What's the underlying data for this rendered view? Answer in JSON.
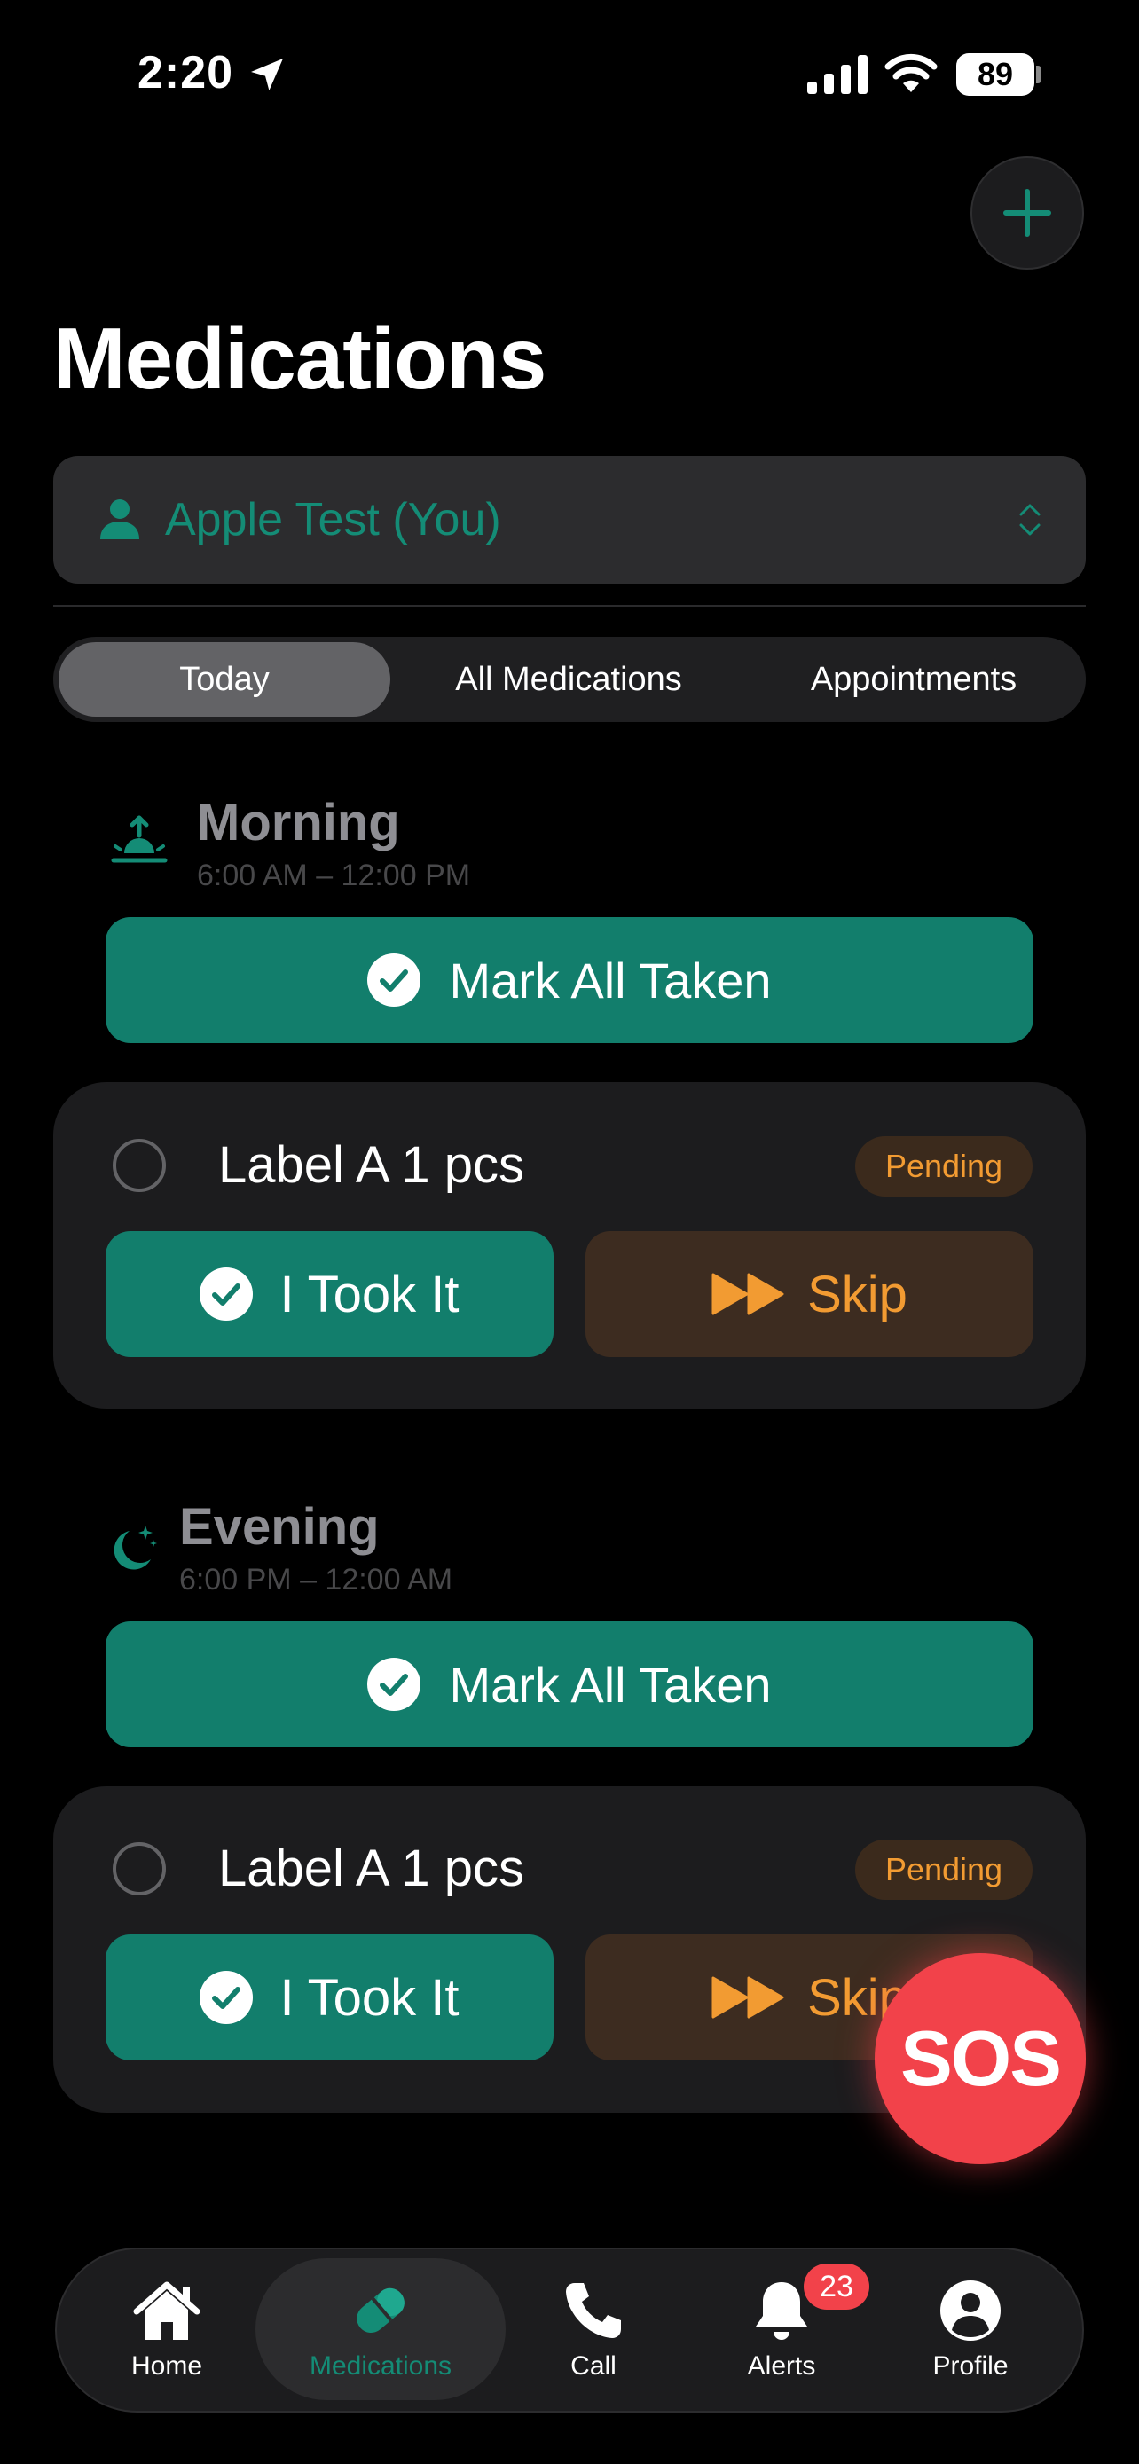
{
  "status_bar": {
    "time": "2:20",
    "battery": "89"
  },
  "header": {
    "title": "Medications"
  },
  "patient_selector": {
    "name": "Apple Test (You)"
  },
  "segments": {
    "today": "Today",
    "all": "All Medications",
    "appointments": "Appointments",
    "selected": "Today"
  },
  "sections": [
    {
      "title": "Morning",
      "time_range": "6:00 AM – 12:00 PM",
      "mark_all_label": "Mark All Taken",
      "meds": [
        {
          "label": "Label A 1 pcs",
          "status": "Pending",
          "took_label": "I Took It",
          "skip_label": "Skip"
        }
      ]
    },
    {
      "title": "Evening",
      "time_range": "6:00 PM – 12:00 AM",
      "mark_all_label": "Mark All Taken",
      "meds": [
        {
          "label": "Label A 1 pcs",
          "status": "Pending",
          "took_label": "I Took It",
          "skip_label": "Skip"
        }
      ]
    }
  ],
  "sos_label": "SOS",
  "tab_bar": {
    "items": [
      {
        "label": "Home",
        "icon": "house-icon"
      },
      {
        "label": "Medications",
        "icon": "pill-icon"
      },
      {
        "label": "Call",
        "icon": "phone-icon"
      },
      {
        "label": "Alerts",
        "icon": "bell-icon"
      },
      {
        "label": "Profile",
        "icon": "profile-icon"
      }
    ],
    "active": "Medications",
    "alerts_badge": "23"
  },
  "colors": {
    "accent": "#127e6c",
    "accent_text": "#148c76",
    "pending": "#f29b32",
    "sos": "#f2424a",
    "background": "#000000",
    "card": "#1c1c1e"
  }
}
